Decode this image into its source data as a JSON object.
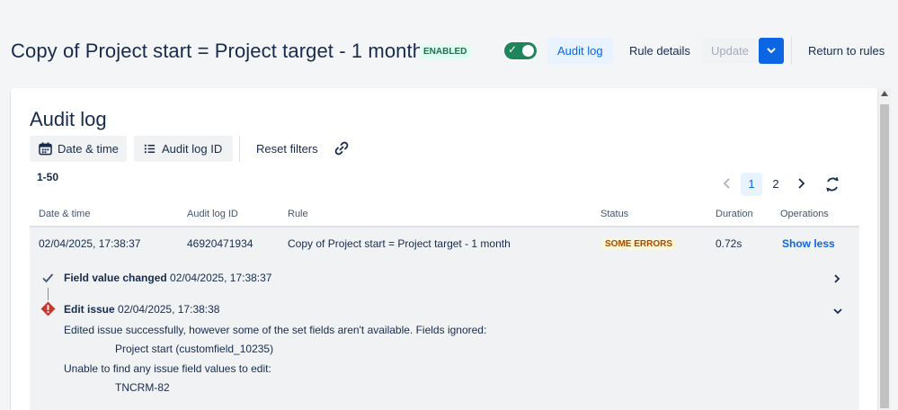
{
  "header": {
    "title": "Copy of Project start = Project target - 1 month",
    "status_badge": "ENABLED",
    "toggle_on": true,
    "buttons": {
      "audit_log": "Audit log",
      "rule_details": "Rule details",
      "update": "Update",
      "return": "Return to rules"
    }
  },
  "panel": {
    "title": "Audit log",
    "filters": {
      "date_time": "Date & time",
      "audit_log_id": "Audit log ID",
      "reset": "Reset filters"
    },
    "range": "1-50",
    "pagination": {
      "pages": [
        "1",
        "2"
      ],
      "current": "1"
    },
    "columns": {
      "date_time": "Date & time",
      "audit_log_id": "Audit log ID",
      "rule": "Rule",
      "status": "Status",
      "duration": "Duration",
      "operations": "Operations"
    },
    "row": {
      "date_time": "02/04/2025, 17:38:37",
      "audit_log_id": "46920471934",
      "rule": "Copy of Project start = Project target - 1 month",
      "status": "SOME ERRORS",
      "duration": "0.72s",
      "operation": "Show less"
    },
    "steps": [
      {
        "name": "Field value changed",
        "time": "02/04/2025, 17:38:37",
        "result": "success"
      },
      {
        "name": "Edit issue",
        "time": "02/04/2025, 17:38:38",
        "result": "error"
      }
    ],
    "messages": {
      "line1": "Edited issue successfully, however some of the set fields aren't available. Fields ignored:",
      "line2": "Project start (customfield_10235)",
      "line3": "Unable to find any issue field values to edit:",
      "line4": "TNCRM-82"
    }
  },
  "colors": {
    "accent": "#0c66e4",
    "toggle": "#1f845a",
    "error": "#c9372c",
    "warning_text": "#a54800"
  }
}
